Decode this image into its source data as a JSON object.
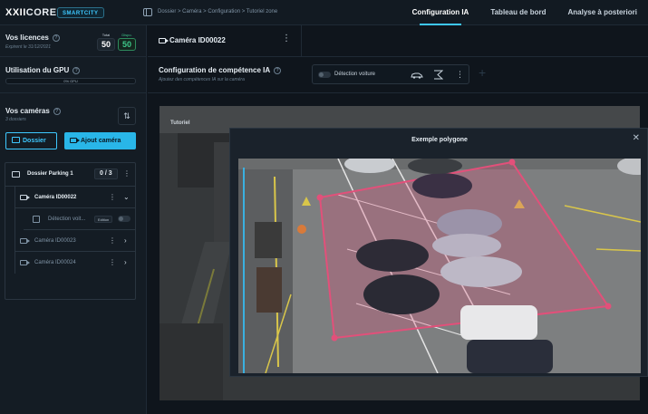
{
  "topbar": {
    "logo_main": "XXII",
    "logo_suffix": "CORE",
    "badge": "SMARTCITY",
    "breadcrumb": "Dossier  >  Caméra  >  Configuration  >  Tutoriel zone",
    "tabs": [
      {
        "label": "Configuration IA",
        "active": true
      },
      {
        "label": "Tableau de bord",
        "active": false
      },
      {
        "label": "Analyse à posteriori",
        "active": false
      }
    ]
  },
  "licences": {
    "title": "Vos licences",
    "expiry": "Expirent le 31/12/2021",
    "total_label": "Total",
    "total_value": "50",
    "dispo_label": "Dispo.",
    "dispo_value": "50"
  },
  "gpu": {
    "title": "Utilisation du GPU",
    "bar_text": "0% GPU",
    "usage_percent": 0
  },
  "cameras": {
    "title": "Vos caméras",
    "subtitle": "3 dossiers",
    "btn_folder": "Dossier",
    "btn_add": "Ajout caméra",
    "tree": {
      "folder": {
        "label": "Dossier Parking 1",
        "count": "0 / 3"
      },
      "items": [
        {
          "label": "Caméra ID00022",
          "expanded": true
        },
        {
          "label": "Détection voit...",
          "badge": "Edition",
          "skill": true
        },
        {
          "label": "Caméra ID00023",
          "expanded": false
        },
        {
          "label": "Caméra ID00024",
          "expanded": false
        }
      ]
    }
  },
  "camera_header": {
    "title": "Caméra ID00022"
  },
  "config": {
    "title": "Configuration de compétence IA",
    "subtitle": "Ajoutez des compétences IA sur la caméra",
    "skill_label": "Détection voiture"
  },
  "preview": {
    "label": "Tutoriel"
  },
  "modal": {
    "title": "Exemple polygone"
  },
  "colors": {
    "accent": "#3ec8ff",
    "dispo": "#3ec88a",
    "polygon": "#e2507a"
  },
  "icons": {
    "help": "help-circle-icon",
    "sort": "sort-arrows-icon",
    "folder": "folder-icon",
    "camera": "video-camera-icon",
    "more": "more-vertical-icon",
    "chevron": "chevron-icon",
    "car": "car-icon",
    "polygon": "polygon-zone-icon",
    "close": "close-icon",
    "add": "plus-icon"
  }
}
